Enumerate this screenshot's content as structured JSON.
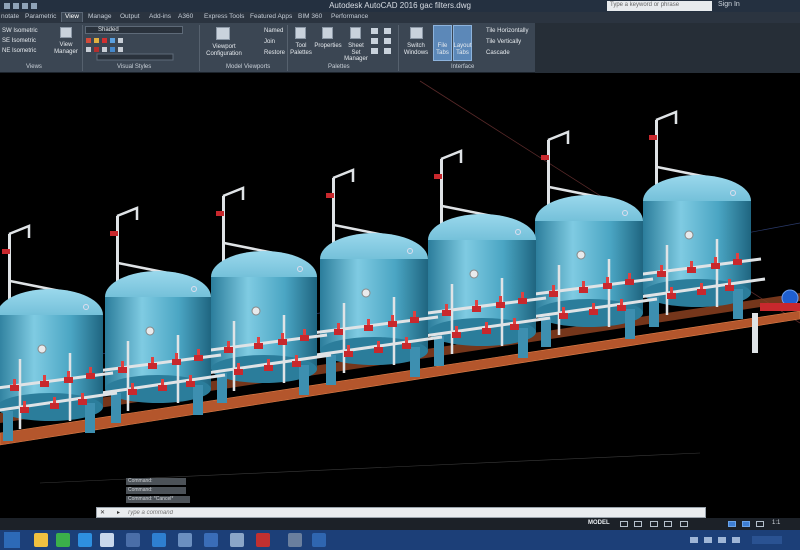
{
  "window": {
    "title": "Autodesk AutoCAD 2016    gac filters.dwg",
    "search_placeholder": "Type a keyword or phrase",
    "signin_label": "Sign In"
  },
  "ribbon": {
    "tabs": [
      "notate",
      "Parametric",
      "View",
      "Manage",
      "Output",
      "Add-ins",
      "A360",
      "Express Tools",
      "Featured Apps",
      "BIM 360",
      "Performance"
    ],
    "active_tab": "View",
    "views_panel": {
      "title": "Views",
      "items": [
        "SW Isometric",
        "SE Isometric",
        "NE Isometric"
      ],
      "view_manager_label": "View Manager"
    },
    "visual_styles_panel": {
      "title": "Visual Styles",
      "current_style": "Shaded"
    },
    "model_viewports_panel": {
      "title": "Model Viewports",
      "viewport_config_label": "Viewport Configuration",
      "items": [
        "Named",
        "Join",
        "Restore"
      ]
    },
    "palettes_panel": {
      "title": "Palettes",
      "items": [
        "Tool Palettes",
        "Properties",
        "Sheet Set Manager"
      ]
    },
    "interface_panel": {
      "title": "Interface",
      "switch_windows_label": "Switch Windows",
      "file_tabs_label": "File Tabs",
      "layout_tabs_label": "Layout Tabs",
      "items": [
        "Tile Horizontally",
        "Tile Vertically",
        "Cascade"
      ]
    }
  },
  "command_line": {
    "history": [
      "Command:",
      "Command:",
      "Command: *Cancel*"
    ],
    "prompt_placeholder": "Type a command"
  },
  "statusbar": {
    "model_label": "MODEL",
    "scale_label": "1:1"
  },
  "colors": {
    "viewport_bg": "#000000",
    "tank_body": "#4fa9c7",
    "pipe_red": "#c8282d",
    "pipe_white": "#dfe3e6",
    "frame_orange": "#b4562c",
    "ribbon_bg": "#3b4653",
    "taskbar": "#1c3f78"
  }
}
